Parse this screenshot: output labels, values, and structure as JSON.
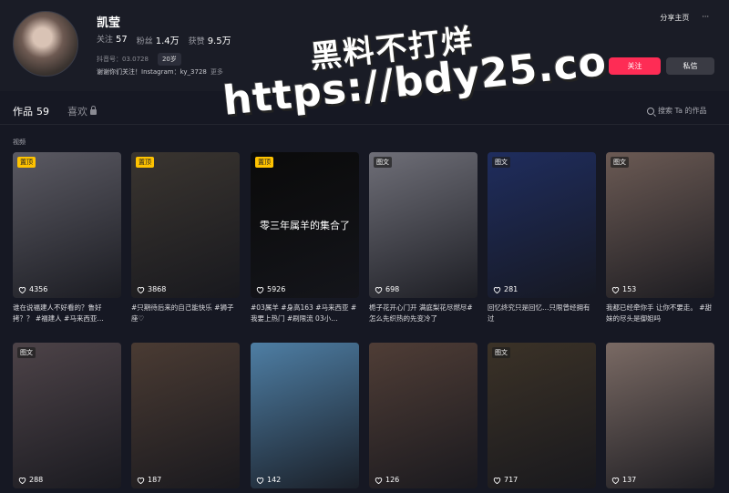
{
  "profile": {
    "name": "凯莹",
    "following_label": "关注",
    "following": "57",
    "followers_label": "粉丝",
    "followers": "1.4万",
    "likes_label": "获赞",
    "likes": "9.5万",
    "douyin_id": "抖音号：03.0728",
    "age": "20岁",
    "bio": "谢谢你们关注！Instagram：ky_3728",
    "bio_more": "更多"
  },
  "actions": {
    "share": "分享主页",
    "more": "···",
    "follow": "关注",
    "message": "私信"
  },
  "tabs": [
    {
      "label": "作品",
      "count": "59"
    },
    {
      "label": "喜欢"
    }
  ],
  "search_placeholder": "搜索 Ta 的作品",
  "section_label": "视频",
  "watermark": {
    "line1": "黑料不打烊",
    "line2": "https://bdy25.co"
  },
  "videos": [
    {
      "badge": "置顶",
      "badge_type": "pin",
      "likes": "4356",
      "caption": "谁在说福建人不好看的？鲁好拷？？ #福建人 #马来西亚…",
      "color": "#5b5a63"
    },
    {
      "badge": "置顶",
      "badge_type": "pin",
      "likes": "3868",
      "caption": "#只期待后来的自己能快乐 #狮子座♡",
      "color": "#3a3530"
    },
    {
      "badge": "置顶",
      "badge_type": "pin",
      "likes": "5926",
      "caption": "#03属羊 #身高163 #马来西亚 #我要上热门 #刷限流 03小…",
      "color": "#0a0a0a",
      "overlay": "零三年属羊的集合了"
    },
    {
      "badge": "图文",
      "badge_type": "img",
      "likes": "698",
      "caption": "栀子花开心门开 满庭梨花尽燃尽#怎么先织热的先变冷了",
      "color": "#6f6f78"
    },
    {
      "badge": "图文",
      "badge_type": "img",
      "likes": "281",
      "caption": "回忆终究只是回忆…只限曾经拥有过",
      "color": "#1f2d5e"
    },
    {
      "badge": "图文",
      "badge_type": "img",
      "likes": "153",
      "caption": "我都已经牵你手 让你不要走。 #甜妹的尽头是御姐吗",
      "color": "#6b5a54"
    },
    {
      "badge": "图文",
      "badge_type": "img",
      "likes": "288",
      "caption": "",
      "color": "#4d4348"
    },
    {
      "likes": "187",
      "caption": "",
      "color": "#4a3b33"
    },
    {
      "likes": "142",
      "caption": "",
      "color": "#4e7ea4"
    },
    {
      "likes": "126",
      "caption": "",
      "color": "#4f3d36"
    },
    {
      "badge": "图文",
      "badge_type": "img",
      "likes": "717",
      "caption": "",
      "color": "#3b3227"
    },
    {
      "likes": "137",
      "caption": "",
      "color": "#7a6a64"
    }
  ]
}
